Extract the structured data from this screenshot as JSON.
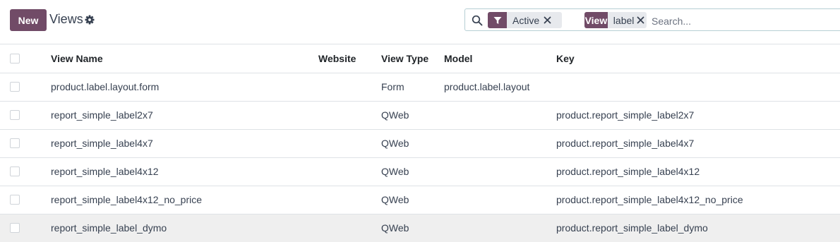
{
  "toolbar": {
    "new_label": "New",
    "title": "Views",
    "settings_icon": "gear-icon"
  },
  "search": {
    "icon": "search-icon",
    "facets": [
      {
        "label_icon": "filter-icon",
        "value": "Active"
      },
      {
        "label": "View",
        "value": "label"
      }
    ],
    "placeholder": "Search..."
  },
  "table": {
    "columns": [
      "View Name",
      "Website",
      "View Type",
      "Model",
      "Key"
    ],
    "rows": [
      {
        "name": "product.label.layout.form",
        "website": "",
        "type": "Form",
        "model": "product.label.layout",
        "key": ""
      },
      {
        "name": "report_simple_label2x7",
        "website": "",
        "type": "QWeb",
        "model": "",
        "key": "product.report_simple_label2x7"
      },
      {
        "name": "report_simple_label4x7",
        "website": "",
        "type": "QWeb",
        "model": "",
        "key": "product.report_simple_label4x7"
      },
      {
        "name": "report_simple_label4x12",
        "website": "",
        "type": "QWeb",
        "model": "",
        "key": "product.report_simple_label4x12"
      },
      {
        "name": "report_simple_label4x12_no_price",
        "website": "",
        "type": "QWeb",
        "model": "",
        "key": "product.report_simple_label4x12_no_price"
      },
      {
        "name": "report_simple_label_dymo",
        "website": "",
        "type": "QWeb",
        "model": "",
        "key": "product.report_simple_label_dymo"
      }
    ]
  },
  "colors": {
    "brand": "#714b67",
    "facet_bg": "#e7e9ed",
    "hover_row": "#efefef",
    "search_border": "#b6cfd4"
  }
}
